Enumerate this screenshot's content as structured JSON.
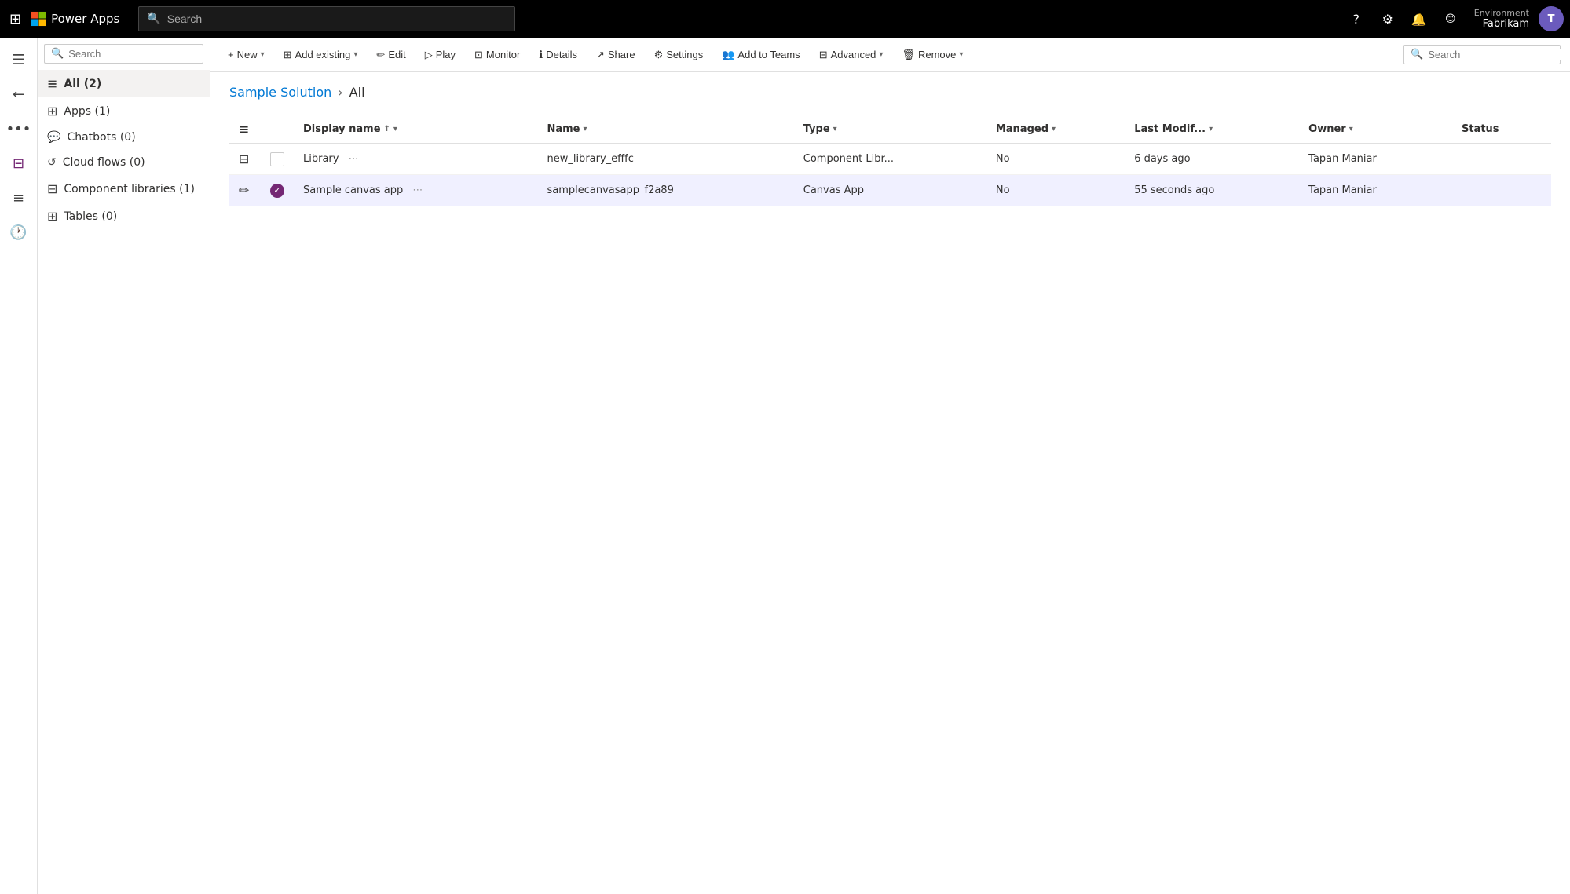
{
  "topbar": {
    "app_name": "Power Apps",
    "search_placeholder": "Search",
    "env_label": "Environment",
    "env_name": "Fabrikam",
    "avatar_initials": "T"
  },
  "sidebar": {
    "search_placeholder": "Search",
    "items": [
      {
        "id": "all",
        "label": "All (2)",
        "icon": "≡",
        "active": true
      },
      {
        "id": "apps",
        "label": "Apps (1)",
        "icon": "⊞"
      },
      {
        "id": "chatbots",
        "label": "Chatbots (0)",
        "icon": "💬"
      },
      {
        "id": "cloudflows",
        "label": "Cloud flows (0)",
        "icon": "↺"
      },
      {
        "id": "componentlibraries",
        "label": "Component libraries (1)",
        "icon": "⊟"
      },
      {
        "id": "tables",
        "label": "Tables (0)",
        "icon": "⊞"
      }
    ]
  },
  "commandbar": {
    "new_label": "New",
    "add_existing_label": "Add existing",
    "edit_label": "Edit",
    "play_label": "Play",
    "monitor_label": "Monitor",
    "details_label": "Details",
    "share_label": "Share",
    "settings_label": "Settings",
    "add_to_teams_label": "Add to Teams",
    "advanced_label": "Advanced",
    "remove_label": "Remove",
    "search_placeholder": "Search"
  },
  "breadcrumb": {
    "parent": "Sample Solution",
    "current": "All"
  },
  "table": {
    "columns": [
      {
        "id": "display_name",
        "label": "Display name",
        "sort": "asc"
      },
      {
        "id": "name",
        "label": "Name",
        "sort": null
      },
      {
        "id": "type",
        "label": "Type",
        "sort": null
      },
      {
        "id": "managed",
        "label": "Managed",
        "sort": null
      },
      {
        "id": "last_modified",
        "label": "Last Modif...",
        "sort": null
      },
      {
        "id": "owner",
        "label": "Owner",
        "sort": null
      },
      {
        "id": "status",
        "label": "Status",
        "sort": null
      }
    ],
    "rows": [
      {
        "id": "row1",
        "display_name": "Library",
        "name": "new_library_efffc",
        "type": "Component Libr...",
        "managed": "No",
        "last_modified": "6 days ago",
        "owner": "Tapan Maniar",
        "status": "",
        "selected": false
      },
      {
        "id": "row2",
        "display_name": "Sample canvas app",
        "name": "samplecanvasapp_f2a89",
        "type": "Canvas App",
        "managed": "No",
        "last_modified": "55 seconds ago",
        "owner": "Tapan Maniar",
        "status": "",
        "selected": true
      }
    ]
  }
}
